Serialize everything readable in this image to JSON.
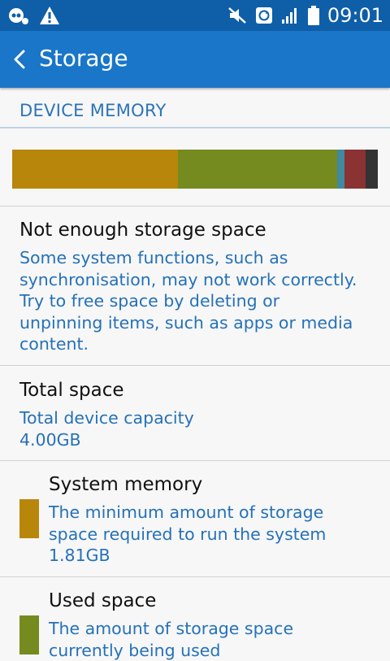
{
  "status_bar": {
    "time": "09:01",
    "left_icons": [
      "voicemail-icon",
      "warning-icon"
    ],
    "right_icons": [
      "mute-icon",
      "sync-icon",
      "signal-icon",
      "battery-icon"
    ]
  },
  "app_bar": {
    "title": "Storage",
    "back_icon": "chevron-left-icon"
  },
  "section_header": "DEVICE MEMORY",
  "storage_bar": {
    "total_gb": 4.0,
    "segments": [
      {
        "name": "system-memory",
        "fraction": 0.453,
        "color": "#b8860b"
      },
      {
        "name": "used-space",
        "fraction": 0.437,
        "color": "#758a1f"
      },
      {
        "name": "segment-3",
        "fraction": 0.02,
        "color": "#3f8aa0"
      },
      {
        "name": "segment-4",
        "fraction": 0.056,
        "color": "#8b3232"
      },
      {
        "name": "segment-5",
        "fraction": 0.034,
        "color": "#333333"
      }
    ]
  },
  "warning": {
    "title": "Not enough storage space",
    "lines": [
      "Some system functions, such as",
      "synchronisation, may not work correctly.",
      "Try to free space by deleting or",
      "unpinning items, such as apps or media",
      "content."
    ]
  },
  "total_space": {
    "title": "Total space",
    "subtitle": "Total device capacity",
    "value": "4.00GB"
  },
  "system_memory": {
    "title": "System memory",
    "lines": [
      "The minimum amount of storage",
      "space required to run the system"
    ],
    "value": "1.81GB",
    "color": "#b8860b"
  },
  "used_space": {
    "title": "Used space",
    "lines": [
      "The amount of storage space",
      "currently being used"
    ],
    "color": "#758a1f"
  }
}
